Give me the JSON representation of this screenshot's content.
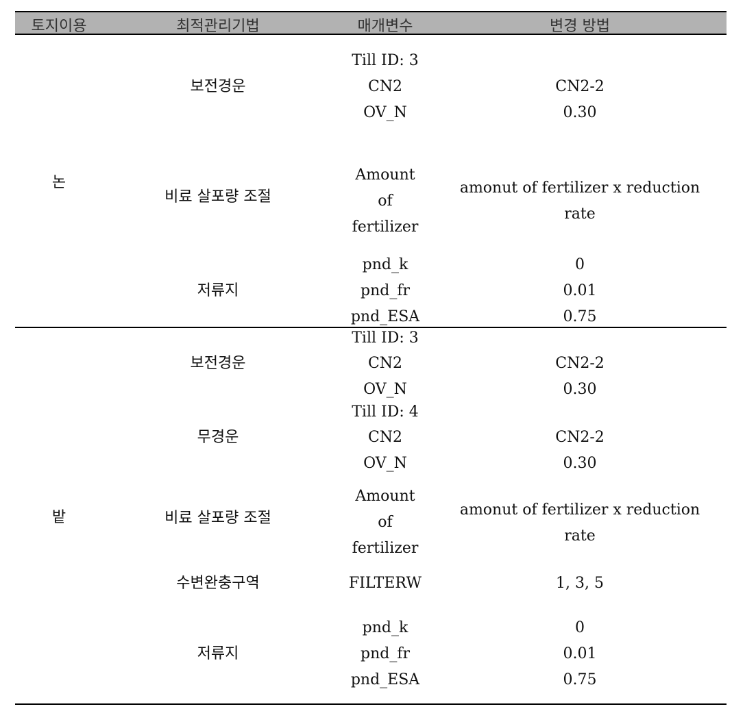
{
  "table": {
    "headers": [
      "토지이용",
      "최적관리기법",
      "매개변수",
      "변경 방법"
    ],
    "groups": [
      {
        "land_use": "논",
        "practices": [
          {
            "name": "보전경운",
            "rows": [
              {
                "param": "Till ID: 3",
                "method": ""
              },
              {
                "param": "CN2",
                "method": "CN2-2"
              },
              {
                "param": "OV_N",
                "method": "0.30"
              }
            ]
          },
          {
            "name": "비료 살포량 조절",
            "rows": [
              {
                "param": "Amount of fertilizer",
                "method": "amonut of fertilizer x reduction rate"
              }
            ]
          },
          {
            "name": "저류지",
            "rows": [
              {
                "param": "pnd_k",
                "method": "0"
              },
              {
                "param": "pnd_fr",
                "method": "0.01"
              },
              {
                "param": "pnd_ESA",
                "method": "0.75"
              }
            ]
          }
        ]
      },
      {
        "land_use": "밭",
        "practices": [
          {
            "name": "보전경운",
            "rows": [
              {
                "param": "Till ID: 3",
                "method": ""
              },
              {
                "param": "CN2",
                "method": "CN2-2"
              },
              {
                "param": "OV_N",
                "method": "0.30"
              }
            ]
          },
          {
            "name": "무경운",
            "rows": [
              {
                "param": "Till ID: 4",
                "method": ""
              },
              {
                "param": "CN2",
                "method": "CN2-2"
              },
              {
                "param": "OV_N",
                "method": "0.30"
              }
            ]
          },
          {
            "name": "비료 살포량 조절",
            "rows": [
              {
                "param": "Amount of fertilizer",
                "method": "amonut of fertilizer x reduction rate"
              }
            ]
          },
          {
            "name": "수변완충구역",
            "rows": [
              {
                "param": "FILTERW",
                "method": "1, 3, 5"
              }
            ]
          },
          {
            "name": "저류지",
            "rows": [
              {
                "param": "pnd_k",
                "method": "0"
              },
              {
                "param": "pnd_fr",
                "method": "0.01"
              },
              {
                "param": "pnd_ESA",
                "method": "0.75"
              }
            ]
          }
        ]
      }
    ]
  }
}
